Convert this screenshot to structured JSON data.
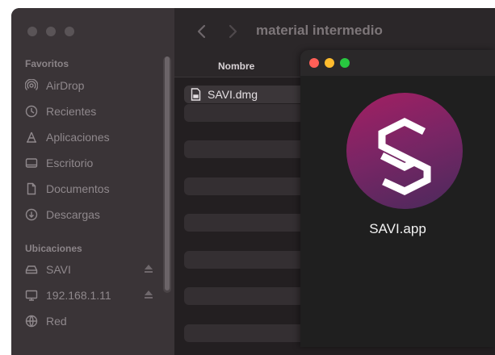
{
  "finder": {
    "title": "material intermedio",
    "sidebar": {
      "favorites_header": "Favoritos",
      "favorites": [
        {
          "label": "AirDrop",
          "icon": "airdrop-icon"
        },
        {
          "label": "Recientes",
          "icon": "clock-icon"
        },
        {
          "label": "Aplicaciones",
          "icon": "applications-icon"
        },
        {
          "label": "Escritorio",
          "icon": "desktop-icon"
        },
        {
          "label": "Documentos",
          "icon": "document-icon"
        },
        {
          "label": "Descargas",
          "icon": "download-icon"
        }
      ],
      "locations_header": "Ubicaciones",
      "locations": [
        {
          "label": "SAVI",
          "icon": "drive-icon",
          "eject": true
        },
        {
          "label": "192.168.1.11",
          "icon": "monitor-icon",
          "eject": true
        },
        {
          "label": "Red",
          "icon": "network-icon",
          "eject": false
        }
      ]
    },
    "column_header": "Nombre",
    "files": [
      {
        "name": "SAVI.dmg",
        "icon": "disk-image-icon"
      }
    ]
  },
  "dmg_window": {
    "traffic_colors": {
      "close": "#ff5f57",
      "minimize": "#febc2e",
      "zoom": "#28c840"
    },
    "app_name": "SAVI.app",
    "app_icon": "savi-logo-icon"
  }
}
